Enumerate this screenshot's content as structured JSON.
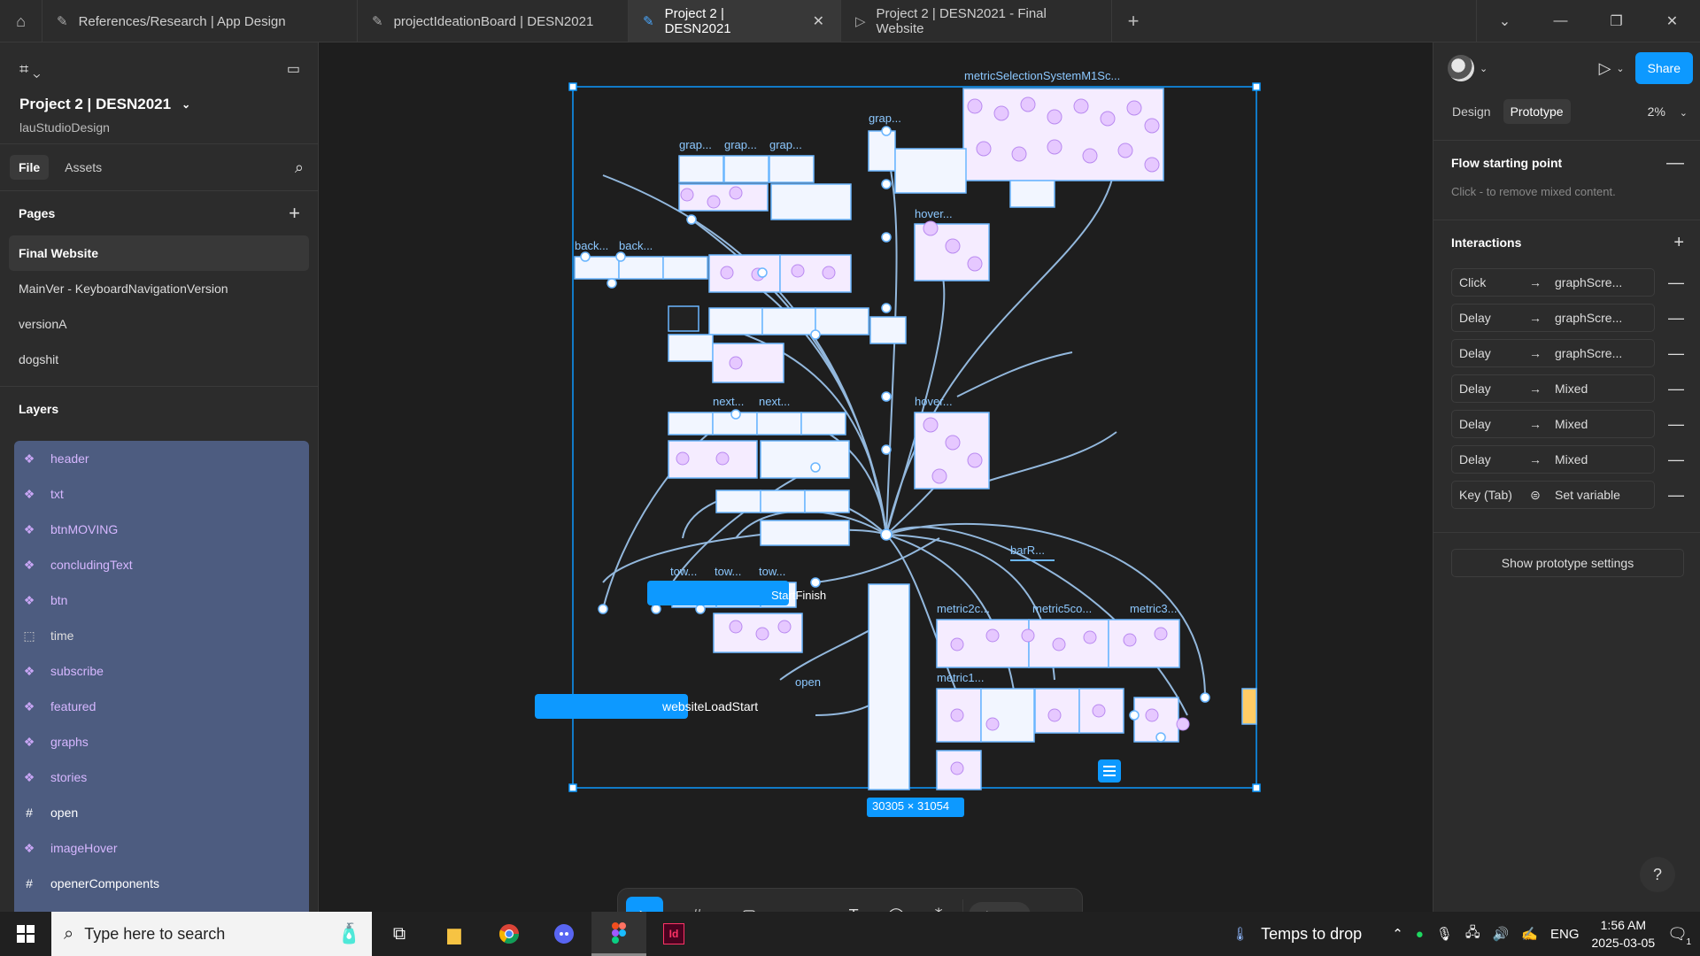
{
  "tabs": [
    {
      "label": "References/Research | App Design",
      "icon": "pen-icon",
      "active": false
    },
    {
      "label": "projectIdeationBoard | DESN2021",
      "icon": "pen-icon",
      "active": false
    },
    {
      "label": "Project 2 | DESN2021",
      "icon": "pen-icon",
      "active": true
    },
    {
      "label": "Project 2 | DESN2021 - Final Website",
      "icon": "play-icon",
      "active": false
    }
  ],
  "file": {
    "title": "Project 2 | DESN2021",
    "team": "lauStudioDesign",
    "tab_file": "File",
    "tab_assets": "Assets"
  },
  "pages": {
    "heading": "Pages",
    "items": [
      "Final Website",
      "MainVer - KeyboardNavigationVersion",
      "versionA",
      "dogshit"
    ]
  },
  "layers": {
    "heading": "Layers",
    "items": [
      {
        "name": "header",
        "type": "component"
      },
      {
        "name": "txt",
        "type": "component"
      },
      {
        "name": "btnMOVING",
        "type": "component"
      },
      {
        "name": "concludingText",
        "type": "component"
      },
      {
        "name": "btn",
        "type": "component"
      },
      {
        "name": "time",
        "type": "placeholder"
      },
      {
        "name": "subscribe",
        "type": "component"
      },
      {
        "name": "featured",
        "type": "component"
      },
      {
        "name": "graphs",
        "type": "component"
      },
      {
        "name": "stories",
        "type": "component"
      },
      {
        "name": "open",
        "type": "frame"
      },
      {
        "name": "imageHover",
        "type": "component"
      },
      {
        "name": "openerComponents",
        "type": "frame"
      }
    ]
  },
  "canvas": {
    "frame_labels": {
      "metric_selection": "metricSelectionSystemM1Sc...",
      "grap1": "grap...",
      "grap2": "grap...",
      "grap3": "grap...",
      "grap4": "grap...",
      "hover1": "hover...",
      "hover2": "hover...",
      "back1": "back...",
      "back2": "back...",
      "next1": "next...",
      "next2": "next...",
      "tow1": "tow...",
      "tow2": "tow...",
      "tow3": "tow...",
      "barR": "barR...",
      "metric2c": "metric2c...",
      "metric5co": "metric5co...",
      "metric3": "metric3...",
      "metric1": "metric1...",
      "open": "open",
      "start_finish": "StartFinish",
      "website_load_start": "websiteLoadStart"
    },
    "selection_size": "30305 × 31054"
  },
  "right_panel": {
    "tab_design": "Design",
    "tab_prototype": "Prototype",
    "zoom": "2%",
    "share_label": "Share",
    "flow_heading": "Flow starting point",
    "flow_hint": "Click - to remove mixed content.",
    "interactions_heading": "Interactions",
    "interactions": [
      {
        "trigger": "Click",
        "target": "graphScre..."
      },
      {
        "trigger": "Delay",
        "target": "graphScre..."
      },
      {
        "trigger": "Delay",
        "target": "graphScre..."
      },
      {
        "trigger": "Delay",
        "target": "Mixed"
      },
      {
        "trigger": "Delay",
        "target": "Mixed"
      },
      {
        "trigger": "Delay",
        "target": "Mixed"
      },
      {
        "trigger": "Key (Tab)",
        "target": "Set variable"
      }
    ],
    "proto_settings": "Show prototype settings"
  },
  "taskbar": {
    "search_placeholder": "Type here to search",
    "weather": "Temps to drop",
    "lang": "ENG",
    "time": "1:56 AM",
    "date": "2025-03-05",
    "notif_count": "1"
  },
  "colors": {
    "accent": "#0d99ff",
    "component": "#d6b7ff",
    "layers_bg": "#4d5c80",
    "connector": "#a8d4ff"
  }
}
